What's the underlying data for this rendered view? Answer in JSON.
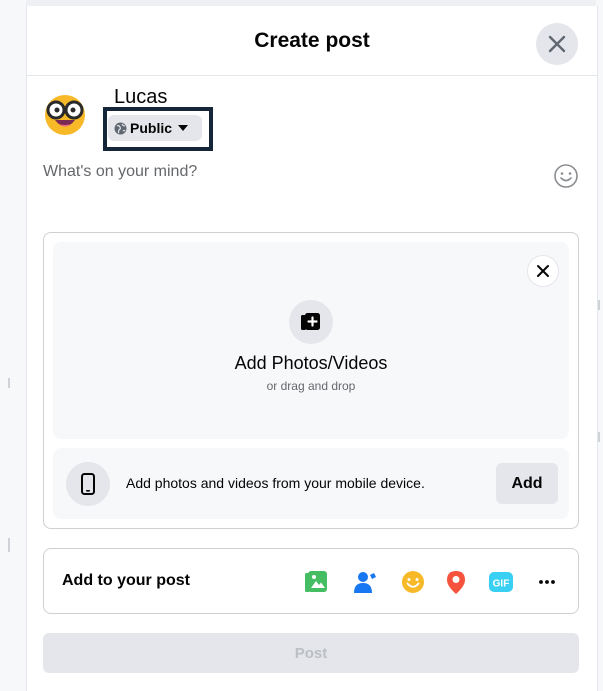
{
  "dialog": {
    "title": "Create post"
  },
  "user": {
    "name": "Lucas",
    "privacy_label": "Public"
  },
  "composer": {
    "placeholder": "What's on your mind?"
  },
  "media": {
    "title": "Add Photos/Videos",
    "subtitle": "or drag and drop",
    "mobile_text": "Add photos and videos from your mobile device.",
    "add_label": "Add"
  },
  "add_to_post": {
    "label": "Add to your post",
    "tools": [
      {
        "icon": "photo-video-icon",
        "color": "#45bd62"
      },
      {
        "icon": "tag-people-icon",
        "color": "#1877f2"
      },
      {
        "icon": "feeling-icon",
        "color": "#f7b928"
      },
      {
        "icon": "check-in-icon",
        "color": "#f5533d"
      },
      {
        "icon": "gif-icon",
        "color": "#3ad0f3"
      },
      {
        "icon": "more-icon",
        "color": "#65676b"
      }
    ]
  },
  "post_button": {
    "label": "Post"
  },
  "colors": {
    "highlight_border": "#152638",
    "disabled_text": "#bcc0c4",
    "secondary_text": "#65676b"
  }
}
